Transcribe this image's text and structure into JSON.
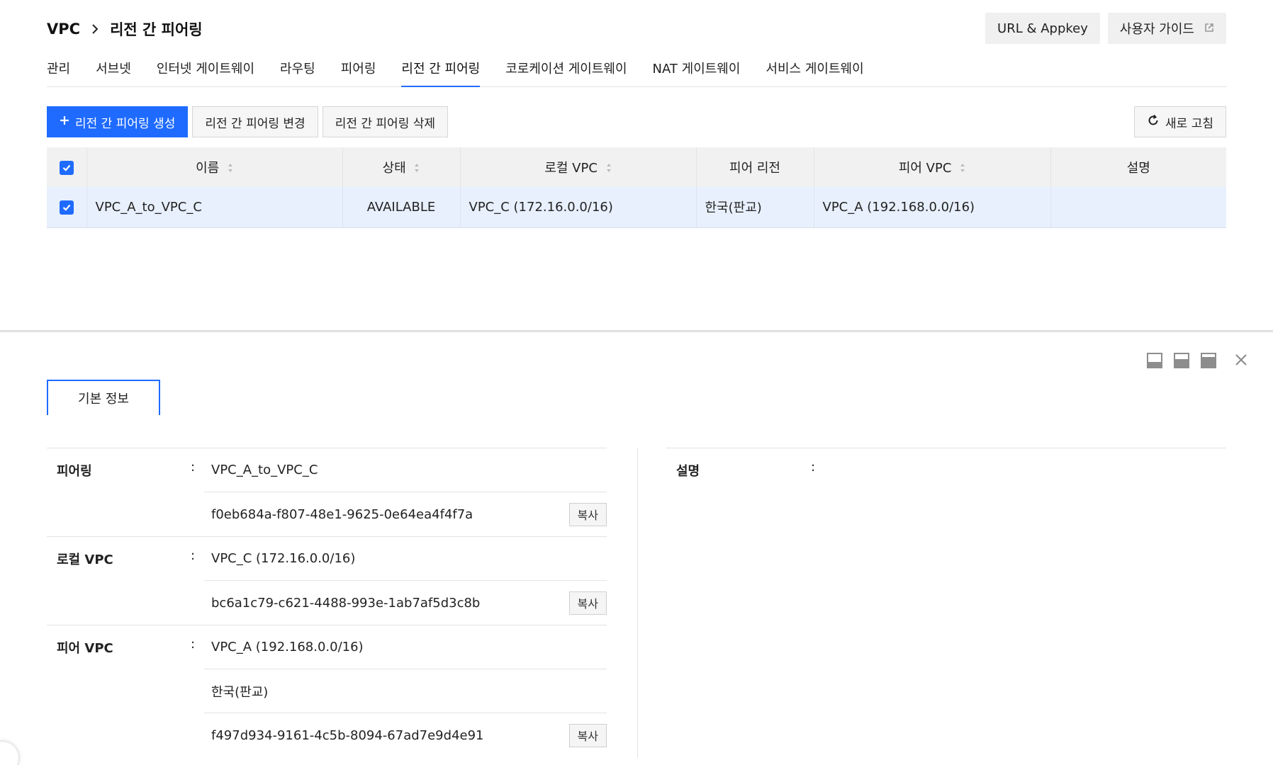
{
  "header": {
    "breadcrumb_root": "VPC",
    "breadcrumb_current": "리전 간 피어링",
    "url_appkey_label": "URL & Appkey",
    "user_guide_label": "사용자 가이드"
  },
  "tabs": [
    {
      "label": "관리"
    },
    {
      "label": "서브넷"
    },
    {
      "label": "인터넷 게이트웨이"
    },
    {
      "label": "라우팅"
    },
    {
      "label": "피어링"
    },
    {
      "label": "리전 간 피어링",
      "active": true
    },
    {
      "label": "코로케이션 게이트웨이"
    },
    {
      "label": "NAT 게이트웨이"
    },
    {
      "label": "서비스 게이트웨이"
    }
  ],
  "toolbar": {
    "create_label": "리전 간 피어링 생성",
    "edit_label": "리전 간 피어링 변경",
    "delete_label": "리전 간 피어링 삭제",
    "refresh_label": "새로 고침"
  },
  "table": {
    "headers": {
      "name": "이름",
      "status": "상태",
      "local_vpc": "로컬 VPC",
      "peer_region": "피어 리전",
      "peer_vpc": "피어 VPC",
      "description": "설명"
    },
    "rows": [
      {
        "name": "VPC_A_to_VPC_C",
        "status": "AVAILABLE",
        "local_vpc": "VPC_C (172.16.0.0/16)",
        "peer_region": "한국(판교)",
        "peer_vpc": "VPC_A (192.168.0.0/16)",
        "description": ""
      }
    ]
  },
  "detail": {
    "tab_label": "기본 정보",
    "colon": ":",
    "copy_label": "복사",
    "peering": {
      "label": "피어링",
      "name": "VPC_A_to_VPC_C",
      "id": "f0eb684a-f807-48e1-9625-0e64ea4f4f7a"
    },
    "local_vpc": {
      "label": "로컬 VPC",
      "name": "VPC_C (172.16.0.0/16)",
      "id": "bc6a1c79-c621-4488-993e-1ab7af5d3c8b"
    },
    "peer_vpc": {
      "label": "피어 VPC",
      "name": "VPC_A (192.168.0.0/16)",
      "region": "한국(판교)",
      "id": "f497d934-9161-4c5b-8094-67ad7e9d4e91"
    },
    "description": {
      "label": "설명",
      "value": ""
    }
  },
  "colors": {
    "accent": "#1f6bff",
    "selected_row": "#e8f0fd",
    "header_bg": "#f1f1f1"
  }
}
